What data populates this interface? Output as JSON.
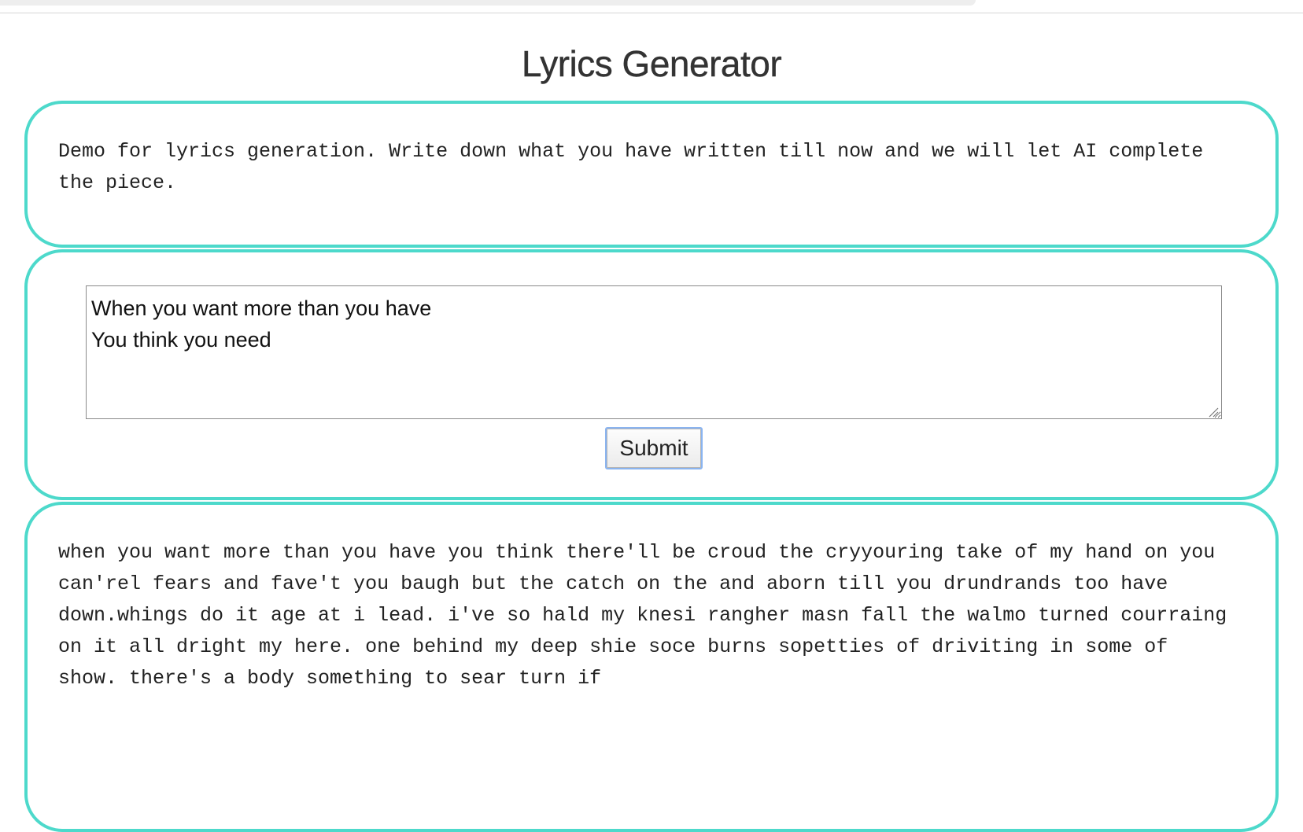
{
  "header": {
    "title": "Lyrics Generator"
  },
  "description": {
    "text": "Demo for lyrics generation. Write down what you have written till now and we will let AI complete the piece."
  },
  "input": {
    "value": "When you want more than you have\nYou think you need",
    "placeholder": ""
  },
  "submit": {
    "label": "Submit"
  },
  "output": {
    "text": "when you want more than you have you think there'll be croud the cryyouring take of my hand on you can'rel fears and fave't you baugh but the catch on the and aborn till you drundrands too have down.whings do it age at i lead. i've so hald my knesi rangher masn fall the walmo turned courraing on it all dright my here. one behind my deep shie soce burns sopetties of driviting in some of show. there's a body something to sear turn if"
  },
  "colors": {
    "panel_border": "#4dd9cb",
    "button_focus": "#8ab4f0",
    "text": "#222222"
  }
}
